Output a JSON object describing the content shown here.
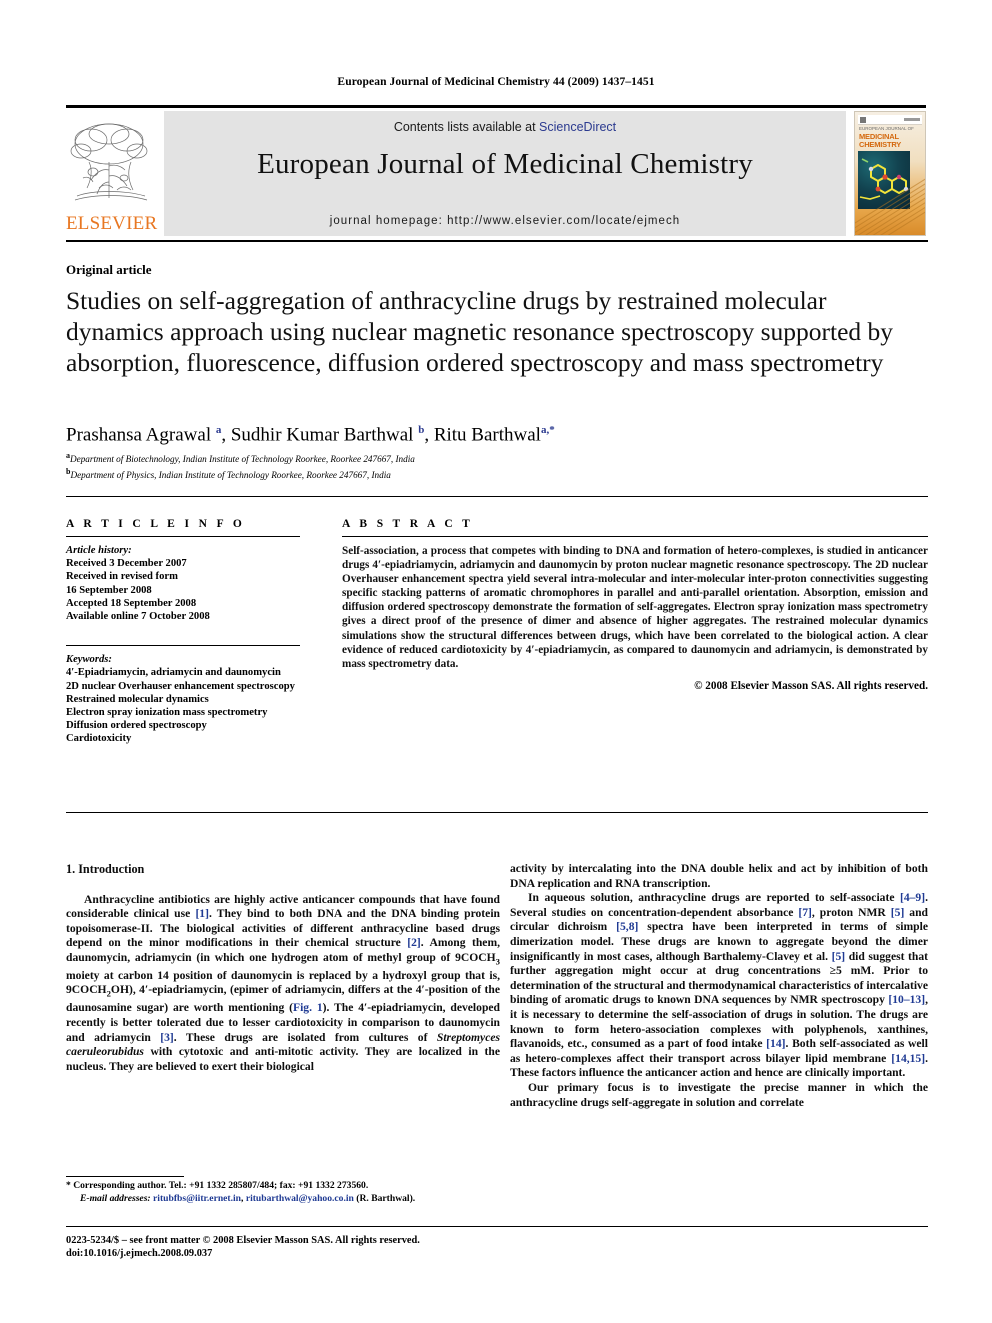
{
  "running_head": "European Journal of Medicinal Chemistry 44 (2009) 1437–1451",
  "masthead": {
    "publisher": "ELSEVIER",
    "contents_prefix": "Contents lists available at ",
    "contents_link": "ScienceDirect",
    "journal_title": "European Journal of Medicinal Chemistry",
    "homepage": "journal homepage: http://www.elsevier.com/locate/ejmech",
    "cover": {
      "overline": "EUROPEAN JOURNAL OF",
      "line1": "MEDICINAL",
      "line2": "CHEMISTRY"
    },
    "link_color": "#2b3a8f",
    "band_color": "#e3e3e3",
    "elsevier_orange": "#E87722"
  },
  "article": {
    "kicker": "Original article",
    "title": "Studies on self-aggregation of anthracycline drugs by restrained molecular dynamics approach using nuclear magnetic resonance spectroscopy supported by absorption, fluorescence, diffusion ordered spectroscopy and mass spectrometry",
    "authors_html": "Prashansa Agrawal <sup>a</sup>, Sudhir Kumar Barthwal <sup>b</sup>, Ritu Barthwal<sup>a,*</sup>",
    "affiliations": [
      {
        "marker": "a",
        "text": "Department of Biotechnology, Indian Institute of Technology Roorkee, Roorkee 247667, India"
      },
      {
        "marker": "b",
        "text": "Department of Physics, Indian Institute of Technology Roorkee, Roorkee 247667, India"
      }
    ]
  },
  "article_info": {
    "heading": "A R T I C L E  I N F O",
    "history_label": "Article history:",
    "history": [
      "Received 3 December 2007",
      "Received in revised form",
      "16 September 2008",
      "Accepted 18 September 2008",
      "Available online 7 October 2008"
    ],
    "keywords_label": "Keywords:",
    "keywords": [
      "4′-Epiadriamycin, adriamycin and daunomycin",
      "2D nuclear Overhauser enhancement spectroscopy",
      "Restrained molecular dynamics",
      "Electron spray ionization mass spectrometry",
      "Diffusion ordered spectroscopy",
      "Cardiotoxicity"
    ]
  },
  "abstract": {
    "heading": "A B S T R A C T",
    "text": "Self-association, a process that competes with binding to DNA and formation of hetero-complexes, is studied in anticancer drugs 4′-epiadriamycin, adriamycin and daunomycin by proton nuclear magnetic resonance spectroscopy. The 2D nuclear Overhauser enhancement spectra yield several intra-molecular and inter-molecular inter-proton connectivities suggesting specific stacking patterns of aromatic chromophores in parallel and anti-parallel orientation. Absorption, emission and diffusion ordered spectroscopy demonstrate the formation of self-aggregates. Electron spray ionization mass spectrometry gives a direct proof of the presence of dimer and absence of higher aggregates. The restrained molecular dynamics simulations show the structural differences between drugs, which have been correlated to the biological action. A clear evidence of reduced cardiotoxicity by 4′-epiadriamycin, as compared to daunomycin and adriamycin, is demonstrated by mass spectrometry data.",
    "copyright": "© 2008 Elsevier Masson SAS. All rights reserved."
  },
  "body": {
    "section_heading": "1. Introduction",
    "left_paragraphs": [
      "Anthracycline antibiotics are highly active anticancer compounds that have found considerable clinical use [1]. They bind to both DNA and the DNA binding protein topoisomerase-II. The biological activities of different anthracycline based drugs depend on the minor modifications in their chemical structure [2]. Among them, daunomycin, adriamycin (in which one hydrogen atom of methyl group of 9COCH3 moiety at carbon 14 position of daunomycin is replaced by a hydroxyl group that is, 9COCH2OH), 4′-epiadriamycin, (epimer of adriamycin, differs at the 4′-position of the daunosamine sugar) are worth mentioning (Fig. 1). The 4′-epiadriamycin, developed recently is better tolerated due to lesser cardiotoxicity in comparison to daunomycin and adriamycin [3]. These drugs are isolated from cultures of Streptomyces caeruleorubidus with cytotoxic and anti-mitotic activity. They are localized in the nucleus. They are believed to exert their biological"
    ],
    "right_paragraphs": [
      "activity by intercalating into the DNA double helix and act by inhibition of both DNA replication and RNA transcription.",
      "In aqueous solution, anthracycline drugs are reported to self-associate [4–9]. Several studies on concentration-dependent absorbance [7], proton NMR [5] and circular dichroism [5,8] spectra have been interpreted in terms of simple dimerization model. These drugs are known to aggregate beyond the dimer insignificantly in most cases, although Barthalemy-Clavey et al. [5] did suggest that further aggregation might occur at drug concentrations ≥5 mM. Prior to determination of the structural and thermodynamical characteristics of intercalative binding of aromatic drugs to known DNA sequences by NMR spectroscopy [10–13], it is necessary to determine the self-association of drugs in solution. The drugs are known to form hetero-association complexes with polyphenols, xanthines, flavanoids, etc., consumed as a part of food intake [14]. Both self-associated as well as hetero-complexes affect their transport across bilayer lipid membrane [14,15]. These factors influence the anticancer action and hence are clinically important.",
      "Our primary focus is to investigate the precise manner in which the anthracycline drugs self-aggregate in solution and correlate"
    ]
  },
  "footnote": {
    "corresponding": "* Corresponding author. Tel.: +91 1332 285807/484; fax: +91 1332 273560.",
    "email_label": "E-mail addresses:",
    "email1": "ritubfbs@iitr.ernet.in",
    "email_sep": ", ",
    "email2": "ritubarthwal@yahoo.co.in",
    "email_suffix": " (R. Barthwal)."
  },
  "footer": {
    "line1": "0223-5234/$ – see front matter © 2008 Elsevier Masson SAS. All rights reserved.",
    "line2": "doi:10.1016/j.ejmech.2008.09.037"
  }
}
